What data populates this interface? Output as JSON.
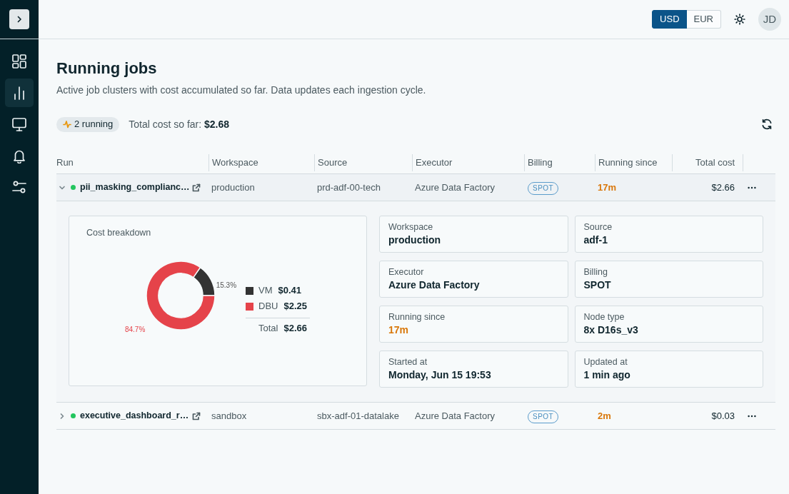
{
  "sidebar": {
    "items": [
      {
        "kind": "dashboard",
        "selected": false
      },
      {
        "kind": "analytics",
        "selected": true
      },
      {
        "kind": "monitor",
        "selected": false
      },
      {
        "kind": "alerts",
        "selected": false
      },
      {
        "kind": "settings",
        "selected": false
      }
    ]
  },
  "header": {
    "currency": [
      {
        "label": "USD",
        "selected": true
      },
      {
        "label": "EUR",
        "selected": false
      }
    ],
    "avatar": "JD"
  },
  "page": {
    "title": "Running jobs",
    "subtitle": "Active job clusters with cost accumulated so far. Data updates each ingestion cycle.",
    "running_badge": "2 running",
    "total_cost": "Total cost so far: **$2.68**"
  },
  "table": {
    "columns": [
      "Run",
      "Workspace",
      "Source",
      "Executor",
      "Billing",
      "Running since",
      "Total cost"
    ],
    "rows": [
      {
        "run": "pii_masking_complianc…",
        "color": "#22c55e",
        "expanded": true,
        "workspace": "production",
        "source": "prd-adf-00-tech",
        "executor": "Azure Data Factory",
        "billing": "SPOT",
        "running_since": "17m",
        "total_cost": "$2.66",
        "details": {
          "cost_breakdown": {
            "chart_data": {
              "type": "donut",
              "title": "Cost breakdown",
              "categories": [
                "VM",
                "DBU"
              ],
              "values": [
                15.3,
                84.7
              ],
              "value_labels": [
                "15.3%",
                "84.7%"
              ]
            },
            "legend": [
              {
                "value": "$0.41",
                "color": "#333333"
              },
              {
                "value": "$2.25",
                "color": "#e5434a"
              }
            ],
            "total": {
              "label": "Total",
              "value": "$2.66"
            }
          },
          "fields": [
            {
              "label": "Workspace",
              "value": "production",
              "highlight": false
            },
            {
              "label": "Source",
              "value": "adf-1",
              "highlight": false
            },
            {
              "label": "Executor",
              "value": "Azure Data Factory",
              "highlight": false
            },
            {
              "label": "Billing",
              "value": "SPOT",
              "highlight": false
            },
            {
              "label": "Running since",
              "value": "17m",
              "highlight": true
            },
            {
              "label": "Node type",
              "value": "8x D16s_v3",
              "highlight": false
            },
            {
              "label": "Started at",
              "value": "Monday, Jun 15 19:53",
              "highlight": false
            },
            {
              "label": "Updated at",
              "value": "1 min ago",
              "highlight": false
            }
          ]
        }
      },
      {
        "run": "executive_dashboard_r…",
        "color": "#22c55e",
        "expanded": false,
        "workspace": "sandbox",
        "source": "sbx-adf-01-datalake",
        "executor": "Azure Data Factory",
        "billing": "SPOT",
        "running_since": "2m",
        "total_cost": "$0.03"
      }
    ]
  }
}
